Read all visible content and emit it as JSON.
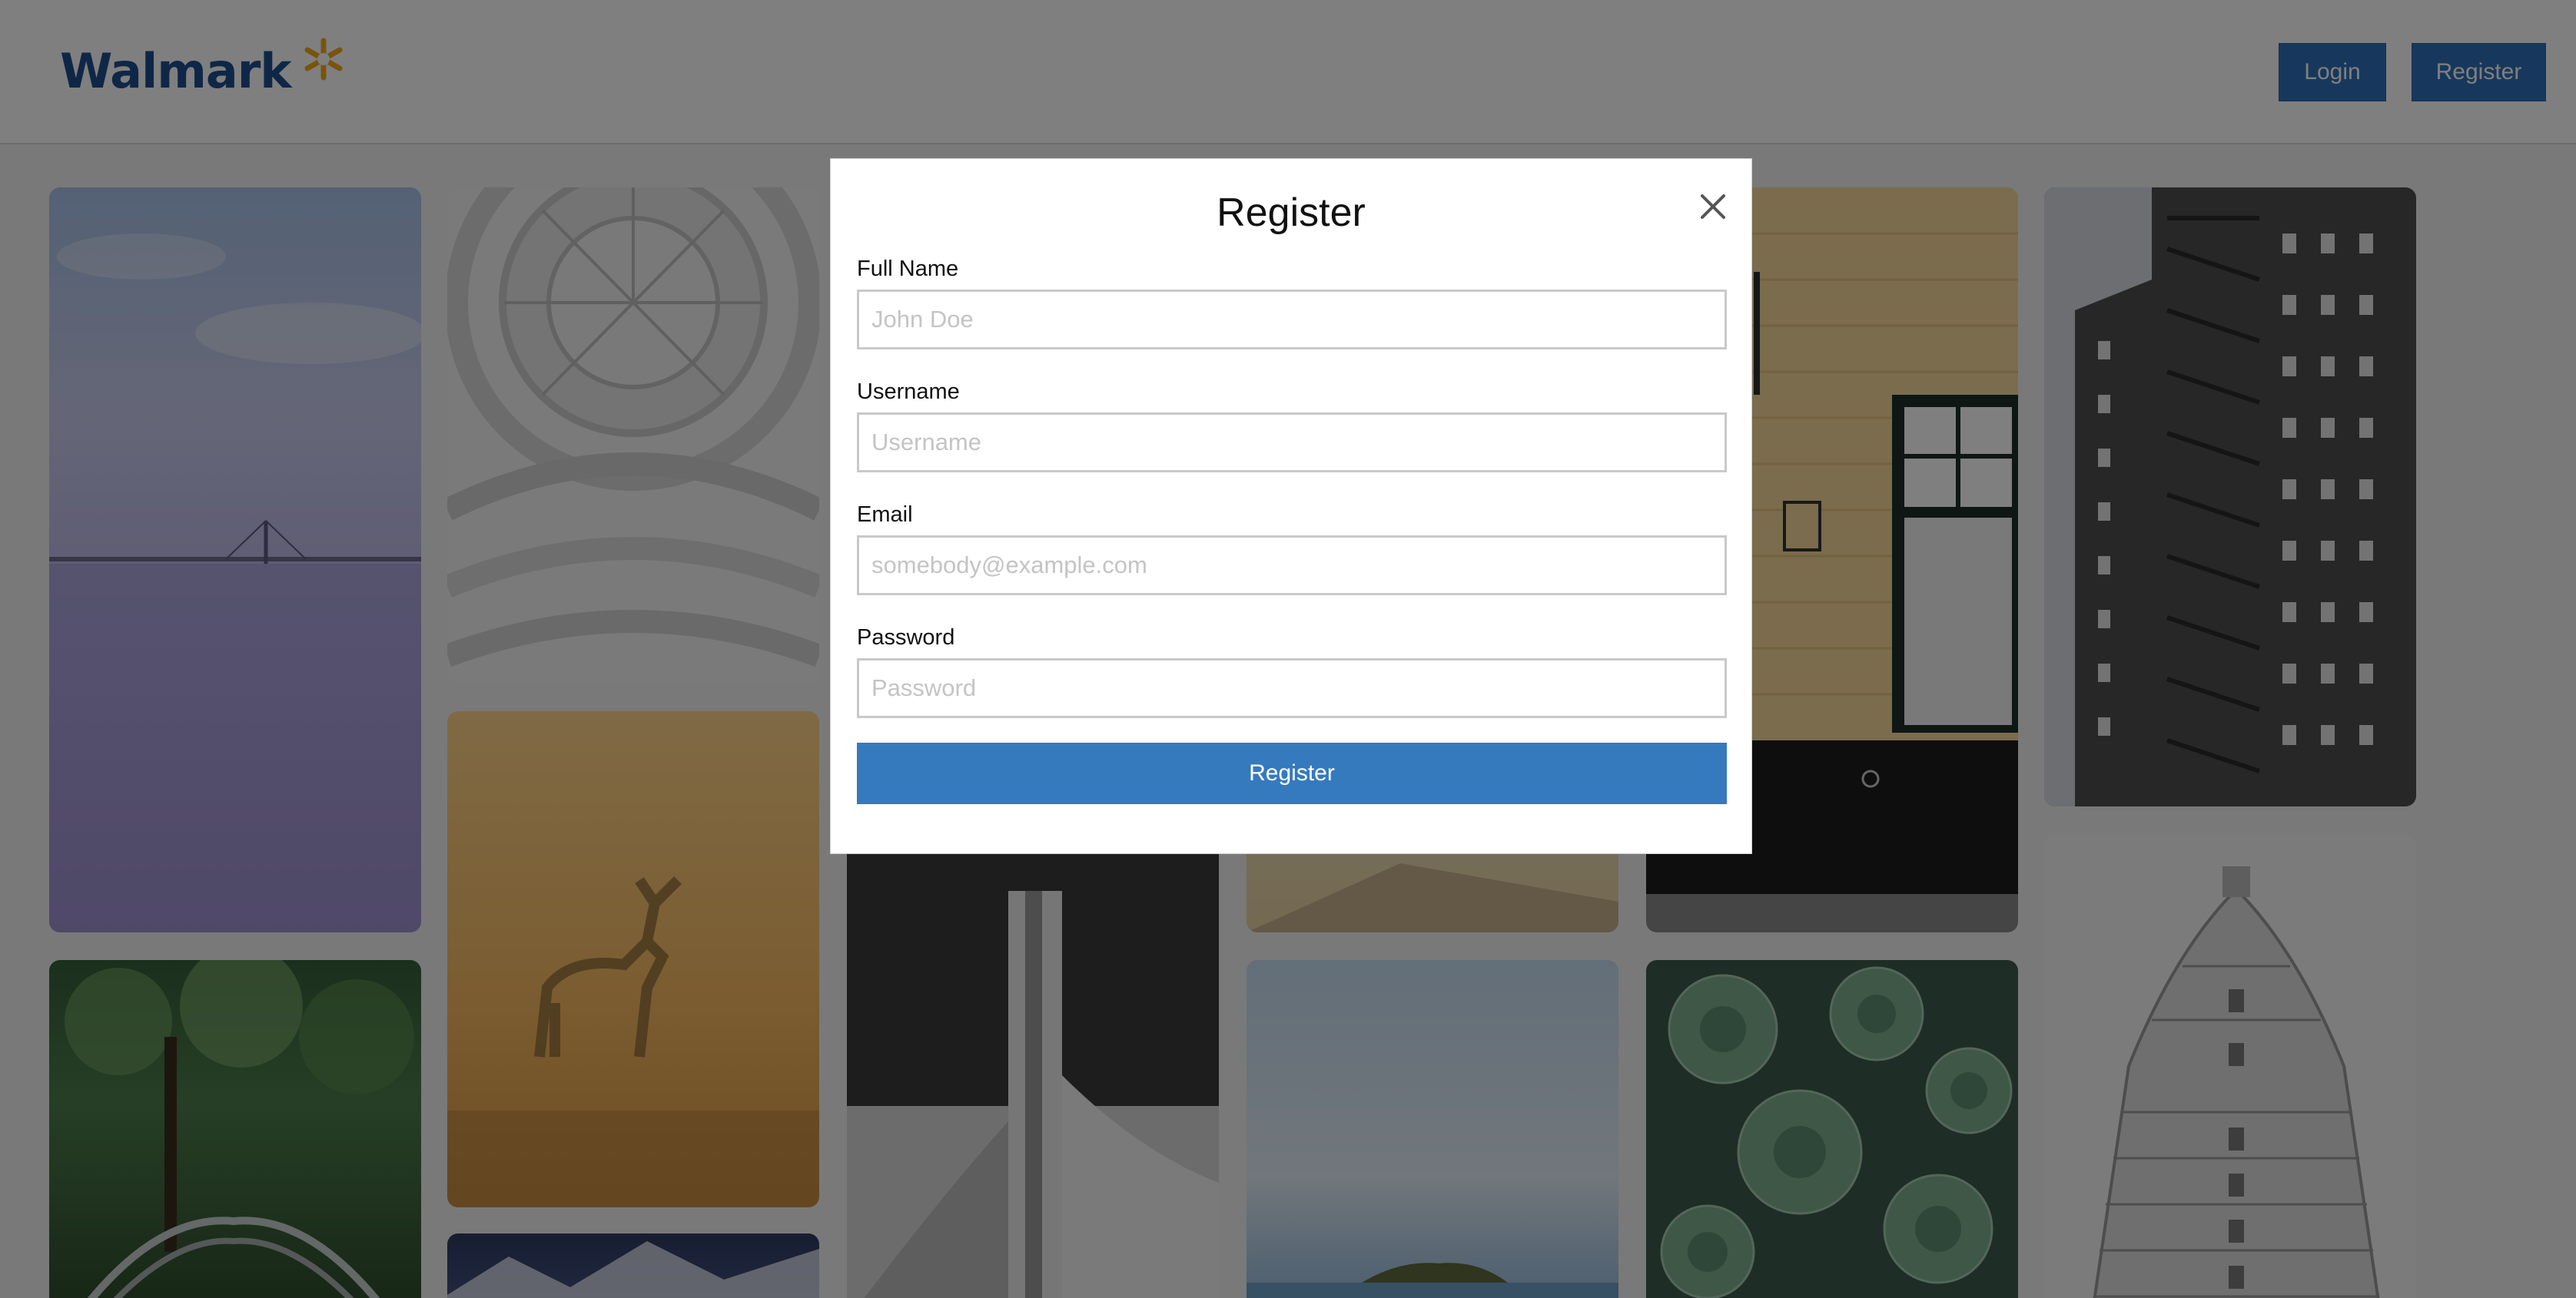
{
  "header": {
    "brand": "Walmark",
    "login_label": "Login",
    "register_label": "Register",
    "accent_color": "#2f71b8",
    "logo_spark_color": "#f2a81d"
  },
  "gallery": {
    "tiles": [
      {
        "subject": "sea bridge sky",
        "icon": "image"
      },
      {
        "subject": "forest bridge",
        "icon": "image"
      },
      {
        "subject": "dome interior",
        "icon": "image"
      },
      {
        "subject": "deer in fog",
        "icon": "image"
      },
      {
        "subject": "mountain",
        "icon": "image"
      },
      {
        "subject": "modern architecture",
        "icon": "image"
      },
      {
        "subject": "beach bench",
        "icon": "image"
      },
      {
        "subject": "sea island",
        "icon": "image"
      },
      {
        "subject": "yellow wall window",
        "icon": "image"
      },
      {
        "subject": "succulents",
        "icon": "image"
      },
      {
        "subject": "brick tower",
        "icon": "image"
      },
      {
        "subject": "flatiron building",
        "icon": "image"
      }
    ]
  },
  "modal": {
    "title": "Register",
    "close_icon": "close-icon",
    "fields": [
      {
        "label": "Full Name",
        "placeholder": "John Doe",
        "value": ""
      },
      {
        "label": "Username",
        "placeholder": "Username",
        "value": ""
      },
      {
        "label": "Email",
        "placeholder": "somebody@example.com",
        "value": ""
      },
      {
        "label": "Password",
        "placeholder": "Password",
        "value": ""
      }
    ],
    "submit_label": "Register",
    "submit_color": "#357abd"
  }
}
